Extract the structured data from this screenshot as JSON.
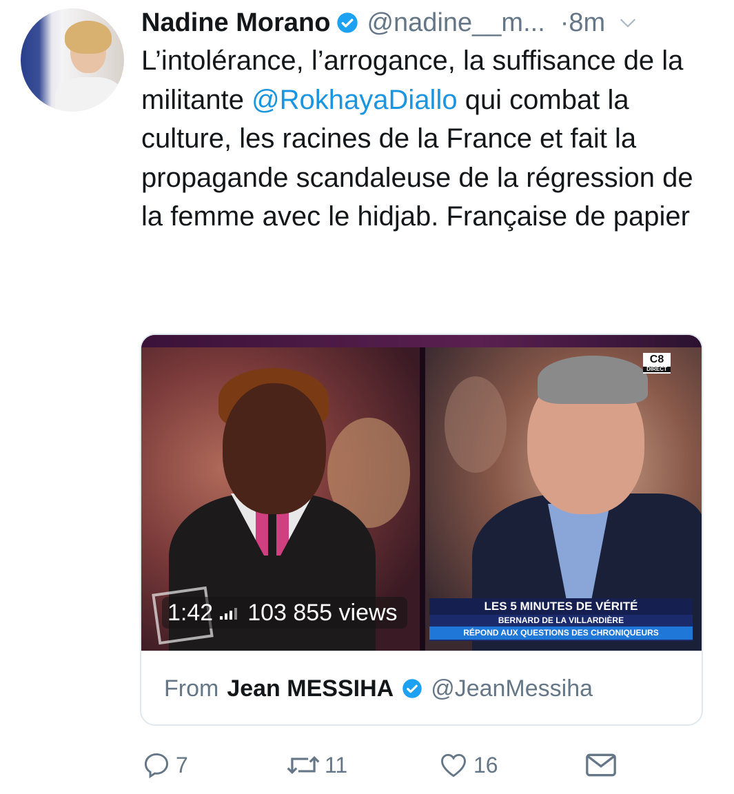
{
  "tweet": {
    "author_name": "Nadine Morano",
    "handle": "@nadine__m...",
    "time": "·8m",
    "text_part1": "L’intolérance, l’arrogance, la suffisance de la militante ",
    "mention": "@RokhayaDiallo",
    "text_part2": " qui combat la culture, les racines de la France et fait la propagande scandaleuse de la régression de la femme avec le hidjab. Française de papier"
  },
  "media": {
    "duration": "1:42",
    "views": "103 855 views",
    "channel_logo": "C8",
    "channel_logo_sub": "DIRECT",
    "banner_title": "LES 5 MINUTES DE VÉRITÉ",
    "banner_sub1": "BERNARD DE LA VILLARDIÈRE",
    "banner_sub2": "RÉPOND AUX QUESTIONS DES CHRONIQUEURS"
  },
  "source": {
    "from_label": "From",
    "name": "Jean MESSIHA",
    "handle": "@JeanMessiha"
  },
  "actions": {
    "replies": "7",
    "retweets": "11",
    "likes": "16"
  },
  "colors": {
    "link": "#1b95e0",
    "muted": "#657786",
    "verified": "#1da1f2",
    "text": "#14171a"
  },
  "icons": [
    "verified-badge-icon",
    "chevron-down-icon",
    "reply-icon",
    "retweet-icon",
    "like-icon",
    "dm-icon",
    "signal-bars-icon"
  ]
}
